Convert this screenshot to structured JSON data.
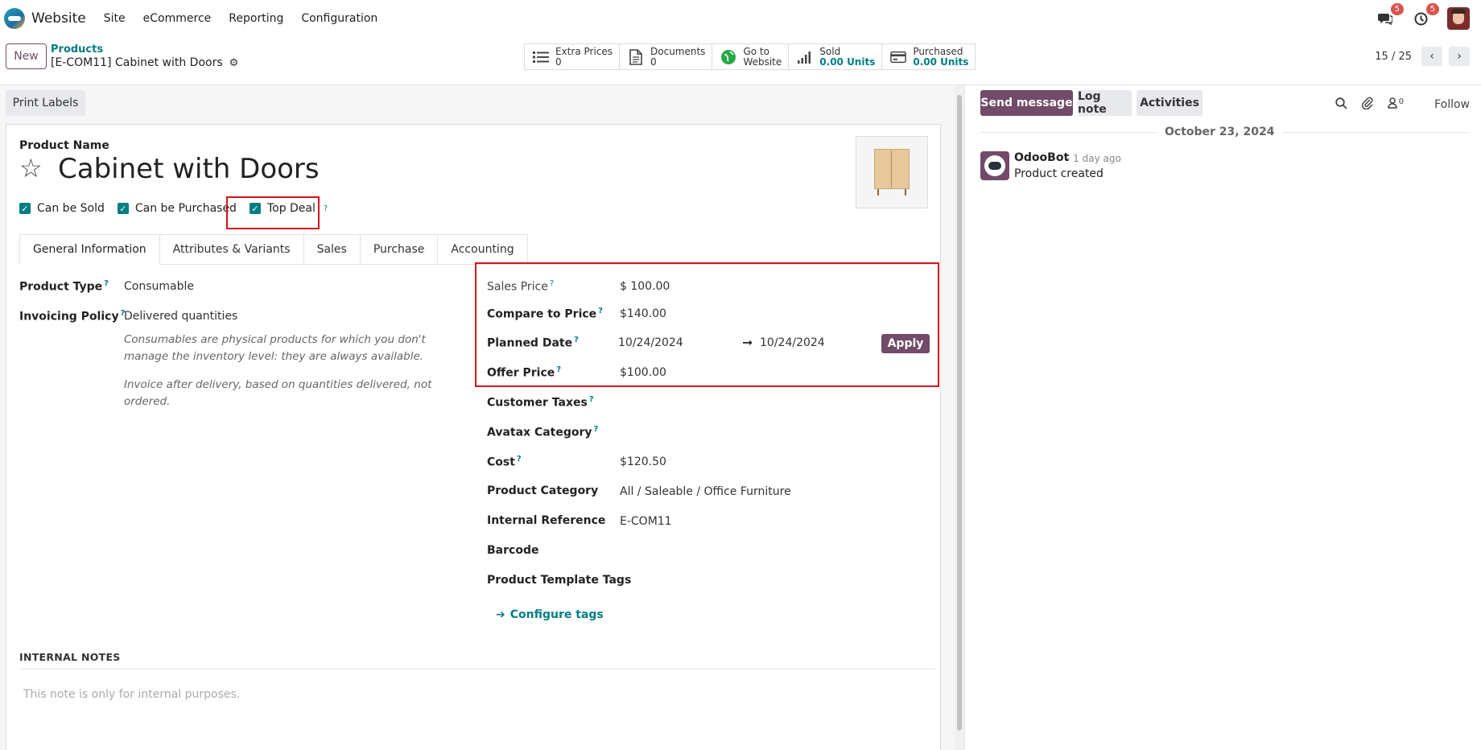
{
  "navbar": {
    "app_name": "Website",
    "menu": [
      "Site",
      "eCommerce",
      "Reporting",
      "Configuration"
    ],
    "messages_badge": "5",
    "activities_badge": "5"
  },
  "control": {
    "new_label": "New",
    "breadcrumb_parent": "Products",
    "breadcrumb_current": "[E-COM11] Cabinet with Doors",
    "smart_buttons": [
      {
        "label": "Extra Prices",
        "value": "0",
        "icon": "list-icon"
      },
      {
        "label": "Documents",
        "value": "0",
        "icon": "document-icon"
      },
      {
        "label": "Go to",
        "value": "Website",
        "icon": "globe-icon"
      },
      {
        "label": "Sold",
        "value": "0.00 Units",
        "icon": "bar-chart-icon"
      },
      {
        "label": "Purchased",
        "value": "0.00 Units",
        "icon": "credit-card-icon"
      }
    ],
    "pager": "15 / 25"
  },
  "form": {
    "print_labels": "Print Labels",
    "product_name_label": "Product Name",
    "product_name": "Cabinet with Doors",
    "checks": [
      {
        "label": "Can be Sold",
        "checked": true,
        "help": false
      },
      {
        "label": "Can be Purchased",
        "checked": true,
        "help": false
      },
      {
        "label": "Top Deal",
        "checked": true,
        "help": true
      }
    ],
    "tabs": [
      "General Information",
      "Attributes & Variants",
      "Sales",
      "Purchase",
      "Accounting"
    ],
    "active_tab": "General Information",
    "left_fields": {
      "product_type_label": "Product Type",
      "product_type": "Consumable",
      "invoicing_policy_label": "Invoicing Policy",
      "invoicing_policy": "Delivered quantities",
      "note1": "Consumables are physical products for which you don't manage the inventory level: they are always available.",
      "note2": "Invoice after delivery, based on quantities delivered, not ordered."
    },
    "right_fields": {
      "sales_price_label": "Sales Price",
      "sales_price": "$ 100.00",
      "compare_price_label": "Compare to Price",
      "compare_price": "$140.00",
      "planned_date_label": "Planned Date",
      "planned_date_from": "10/24/2024",
      "planned_date_to": "10/24/2024",
      "apply_label": "Apply",
      "offer_price_label": "Offer Price",
      "offer_price": "$100.00",
      "customer_taxes_label": "Customer Taxes",
      "avatax_label": "Avatax Category",
      "cost_label": "Cost",
      "cost": "$120.50",
      "category_label": "Product Category",
      "category": "All / Saleable / Office Furniture",
      "internal_ref_label": "Internal Reference",
      "internal_ref": "E-COM11",
      "barcode_label": "Barcode",
      "tags_label": "Product Template Tags",
      "configure_tags": "Configure tags"
    },
    "internal_notes_title": "INTERNAL NOTES",
    "internal_notes_placeholder": "This note is only for internal purposes."
  },
  "chatter": {
    "send_message": "Send message",
    "log_note": "Log note",
    "activities": "Activities",
    "followers_count": "0",
    "follow": "Follow",
    "date": "October 23, 2024",
    "author": "OdooBot",
    "time": "- 1 day ago",
    "body": "Product created"
  },
  "colors": {
    "primary": "#714b67",
    "accent": "#017e84",
    "highlight": "#d8111b"
  }
}
